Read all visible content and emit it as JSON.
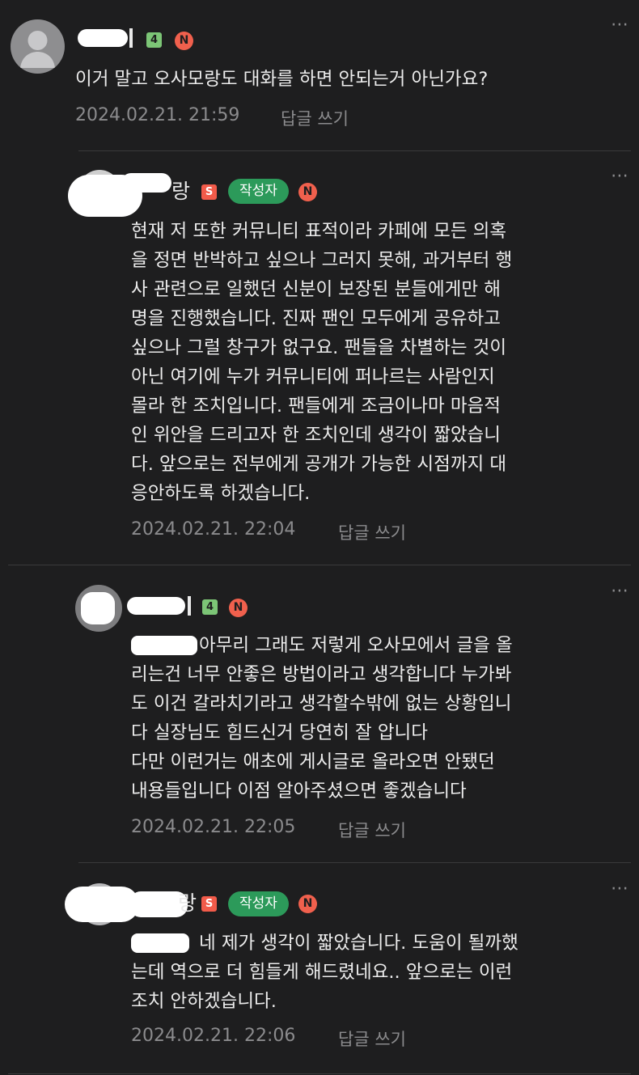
{
  "comments": [
    {
      "level_badge": "4",
      "n_badge": "N",
      "text": "이거 말고 오사모랑도 대화를 하면 안되는거 아닌가요?",
      "date": "2024.02.21. 21:59",
      "reply_label": "답글 쓰기",
      "more": "⋯"
    },
    {
      "nick_tail": "랑",
      "s_badge": "S",
      "writer_label": "작성자",
      "n_badge": "N",
      "text": "현재 저 또한 커뮤니티 표적이라 카페에 모든 의혹\n을 정면 반박하고 싶으나 그러지 못해, 과거부터 행\n사 관련으로 일했던 신분이 보장된 분들에게만 해\n명을 진행했습니다. 진짜 팬인 모두에게 공유하고\n싶으나 그럴 창구가 없구요. 팬들을 차별하는 것이\n아닌 여기에 누가 커뮤니티에 퍼나르는 사람인지\n몰라 한 조치입니다. 팬들에게 조금이나마 마음적\n인 위안을 드리고자 한 조치인데 생각이 짧았습니\n다. 앞으로는 전부에게 공개가 가능한 시점까지 대\n응안하도록 하겠습니다.",
      "date": "2024.02.21. 22:04",
      "reply_label": "답글 쓰기",
      "more": "⋯"
    },
    {
      "level_badge": "4",
      "n_badge": "N",
      "text": "아무리 그래도 저렇게 오사모에서 글을 올\n리는건 너무 안좋은 방법이라고 생각합니다 누가봐\n도 이건 갈라치기라고 생각할수밖에 없는 상황입니\n다 실장님도 힘드신거 당연히 잘 압니다\n다만 이런거는 애초에 게시글로 올라오면 안됐던\n내용들입니다 이점 알아주셨으면 좋겠습니다",
      "date": "2024.02.21. 22:05",
      "reply_label": "답글 쓰기",
      "more": "⋯"
    },
    {
      "nick_tail": "랑",
      "s_badge": "S",
      "writer_label": "작성자",
      "n_badge": "N",
      "text": "네 제가 생각이 짧았습니다. 도움이 될까했\n는데 역으로 더 힘들게 해드렸네요.. 앞으로는 이런\n조치 안하겠습니다.",
      "date": "2024.02.21. 22:06",
      "reply_label": "답글 쓰기",
      "more": "⋯"
    }
  ],
  "colors": {
    "background": "#1e1e1f",
    "writer_badge": "#2c9a5a",
    "n_badge": "#f0604d",
    "level_badge": "#7cc576",
    "mention": "#3d7ff0"
  }
}
